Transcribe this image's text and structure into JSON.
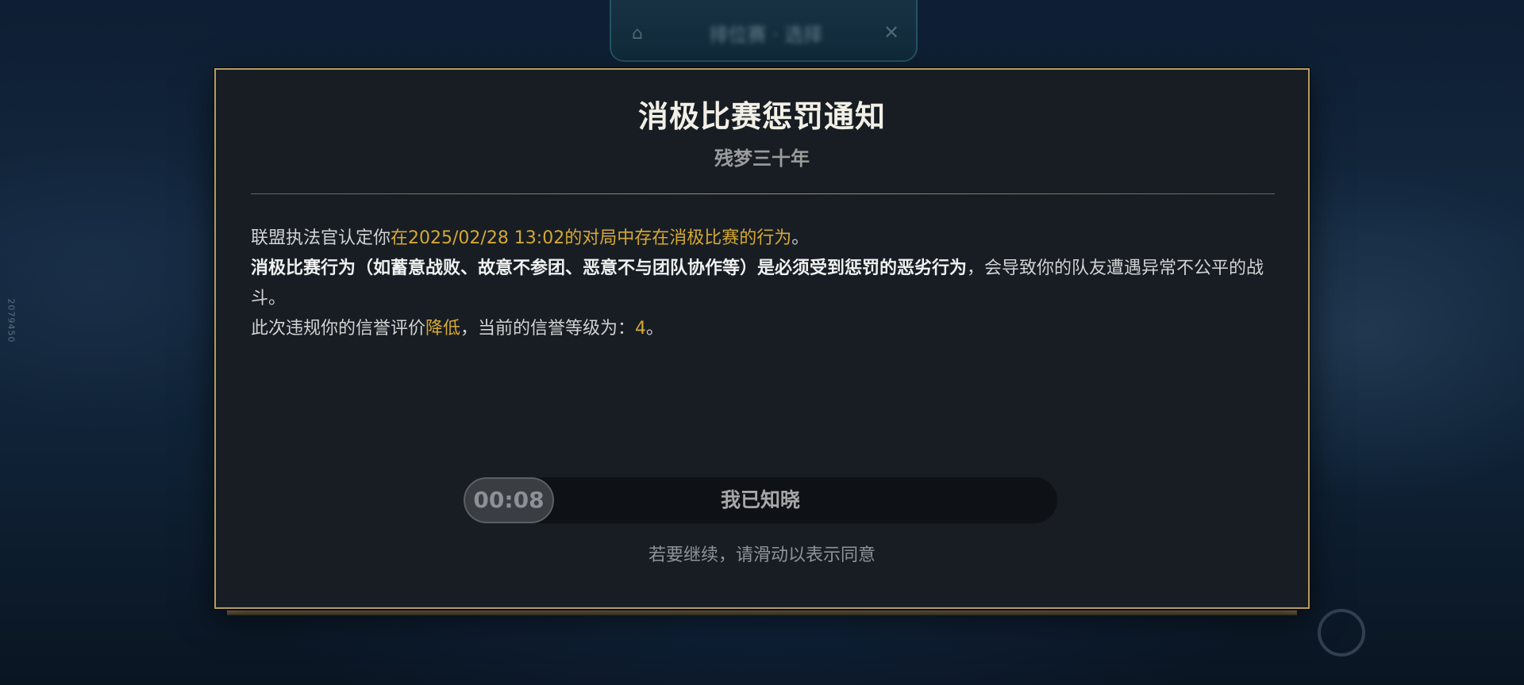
{
  "background": {
    "top_panel_title": "排位赛 · 选择",
    "side_text": "2079450",
    "home_icon": "home-icon",
    "close_icon": "close-icon"
  },
  "dialog": {
    "title": "消极比赛惩罚通知",
    "subtitle": "残梦三十年",
    "line1": {
      "prefix": "联盟执法官认定你",
      "highlight": "在2025/02/28 13:02的对局中存在消极比赛的行为",
      "suffix": "。"
    },
    "line2": {
      "strong": "消极比赛行为（如蓄意战败、故意不参团、恶意不与团队协作等）是必须受到惩罚的恶劣行为",
      "rest": "，会导致你的队友遭遇异常不公平的战斗。"
    },
    "line3": {
      "prefix": "此次违规你的信誉评价",
      "highlight_action": "降低",
      "middle": "，当前的信誉等级为：",
      "level": "4",
      "suffix": "。"
    },
    "slider": {
      "timer": "00:08",
      "label": "我已知晓"
    },
    "hint": "若要继续，请滑动以表示同意"
  },
  "colors": {
    "accent_gold": "#d6a833",
    "border_gold": "#b89b5e",
    "panel_bg": "#171d23"
  }
}
